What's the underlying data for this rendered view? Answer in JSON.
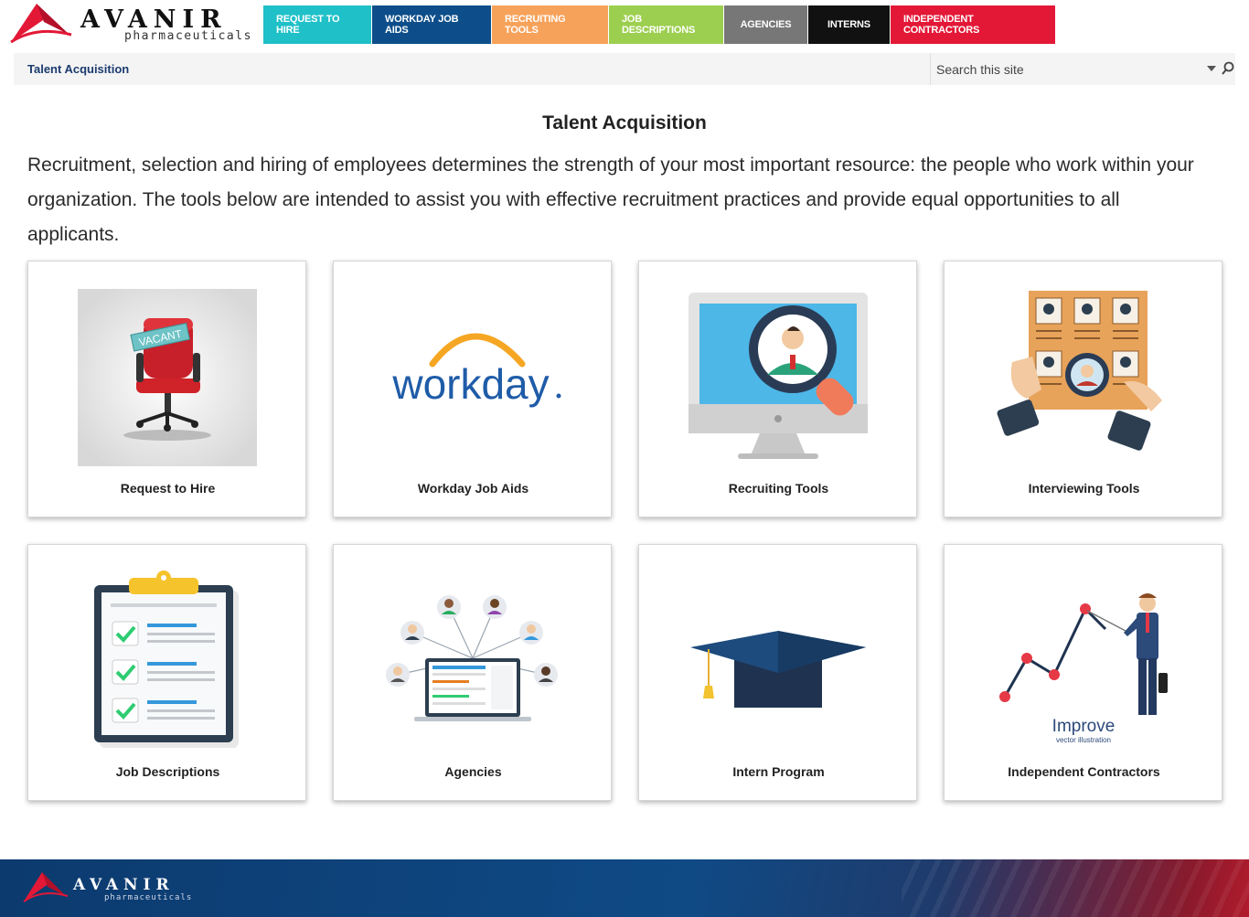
{
  "brand": {
    "name": "AVANIR",
    "tagline": "pharmaceuticals"
  },
  "topnav": [
    {
      "label": "Request to Hire",
      "color": "#1fc0c8"
    },
    {
      "label": "Workday Job Aids",
      "color": "#0d4e8a"
    },
    {
      "label": "Recruiting Tools",
      "color": "#f7a25a"
    },
    {
      "label": "Job Descriptions",
      "color": "#9ccf4f"
    },
    {
      "label": "Agencies",
      "color": "#777777"
    },
    {
      "label": "Interns",
      "color": "#111111"
    },
    {
      "label": "Independent Contractors",
      "color": "#e31837"
    }
  ],
  "breadcrumb": {
    "label": "Talent Acquisition"
  },
  "search": {
    "placeholder": "Search this site"
  },
  "main": {
    "title": "Talent Acquisition",
    "intro": "Recruitment, selection and hiring of employees determines the strength of your most important resource: the people who work within your organization. The tools below are intended to assist you with effective recruitment practices and provide equal opportunities to all applicants."
  },
  "tiles": [
    {
      "label": "Request to Hire",
      "icon": "vacant-chair-icon",
      "sign": "VACANT"
    },
    {
      "label": "Workday Job Aids",
      "icon": "workday-logo",
      "logo_text": "workday"
    },
    {
      "label": "Recruiting Tools",
      "icon": "monitor-magnifier-icon"
    },
    {
      "label": "Interviewing Tools",
      "icon": "candidate-board-icon"
    },
    {
      "label": "Job Descriptions",
      "icon": "clipboard-checklist-icon"
    },
    {
      "label": "Agencies",
      "icon": "laptop-network-icon"
    },
    {
      "label": "Intern Program",
      "icon": "graduation-cap-icon"
    },
    {
      "label": "Independent Contractors",
      "icon": "improve-chart-icon",
      "caption": "Improve",
      "subcaption": "vector illustration"
    }
  ],
  "colors": {
    "accent_red": "#e31837",
    "navy": "#1b3b6f"
  }
}
